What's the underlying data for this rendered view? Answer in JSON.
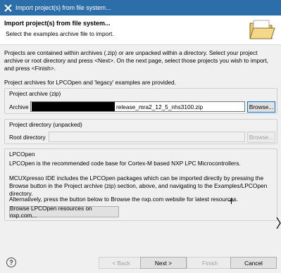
{
  "window": {
    "title": "Import project(s) from file system..."
  },
  "banner": {
    "heading": "Import project(s) from file system...",
    "subtitle": "Select the examples archive file to import."
  },
  "intro": {
    "paragraph1": "Projects are contained within archives (.zip) or are unpacked within a directory. Select your project archive or root directory and press <Next>. On the next page, select those projects you wish to import, and press <Finish>.",
    "paragraph2": "Project archives for LPCOpen and 'legacy' examples are provided."
  },
  "archive_group": {
    "legend": "Project archive (zip)",
    "label": "Archive",
    "value_suffix": "release_mra2_12_5_nhs3100.zip",
    "browse_label": "Browse..."
  },
  "directory_group": {
    "legend": "Project directory (unpacked)",
    "label": "Root directory",
    "value": "",
    "browse_label": "Browse..."
  },
  "lpcopen_group": {
    "legend": "LPCOpen",
    "text1": "LPCOpen is the recommended code base for Cortex-M based NXP LPC Microcontrollers.",
    "text2": "MCUXpresso IDE includes the LPCOpen packages which can be imported directly by pressing the Browse button in the Project archive (zip) section, above, and navigating to the Examples/LPCOpen directory.",
    "text3": "Alternatively, press the button below to Browse the nxp.com website for latest resources.",
    "browse_web_label": "Browse LPCOpen resources on nxp.com..."
  },
  "footer": {
    "help_label": "?",
    "back_label": "< Back",
    "next_label": "Next >",
    "finish_label": "Finish",
    "cancel_label": "Cancel"
  },
  "colors": {
    "titlebar": "#2b6ea9",
    "focus_border": "#0078d7"
  }
}
